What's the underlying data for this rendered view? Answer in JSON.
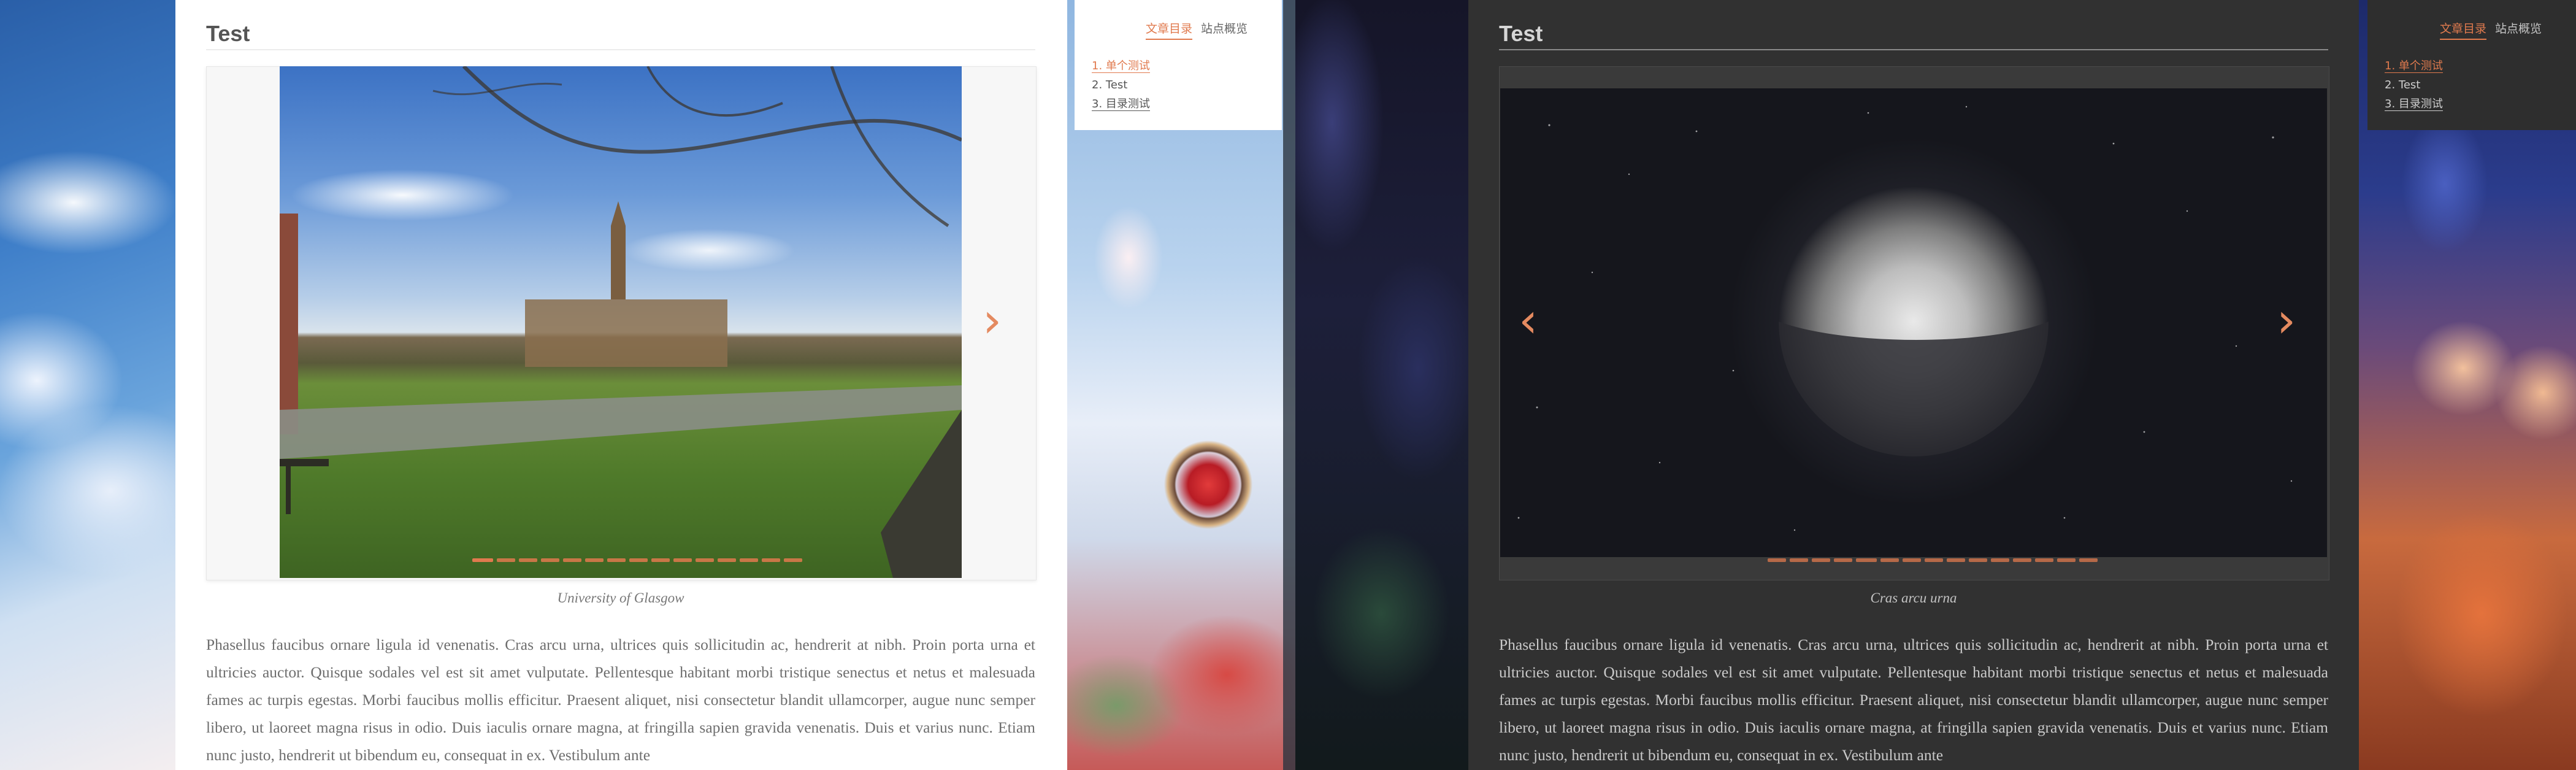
{
  "colors": {
    "accent": "#e07a4e",
    "light_panel": "#ffffff",
    "dark_panel": "#313131"
  },
  "light": {
    "title": "Test",
    "gallery": {
      "slide_caption": "University of Glasgow",
      "slide_count": 15,
      "active_index": 0,
      "next_icon": "chevron-right-icon"
    },
    "paragraph": "Phasellus faucibus ornare ligula id venenatis. Cras arcu urna, ultrices quis sollicitudin ac, hendrerit at nibh. Proin porta urna et ultricies auctor. Quisque sodales vel est sit amet vulputate. Pellentesque habitant morbi tristique senectus et netus et malesuada fames ac turpis egestas. Morbi faucibus mollis efficitur. Praesent aliquet, nisi consectetur blandit ullamcorper, augue nunc semper libero, ut laoreet magna risus in odio. Duis iaculis ornare magna, at fringilla sapien gravida venenatis. Duis et varius nunc. Etiam nunc justo, hendrerit ut bibendum eu, consequat in ex. Vestibulum ante",
    "toc": {
      "tab_toc": "文章目录",
      "tab_overview": "站点概览",
      "items": [
        "1. 单个测试",
        "2. Test",
        "3. 目录测试"
      ]
    }
  },
  "dark": {
    "title": "Test",
    "gallery": {
      "slide_caption": "Cras arcu urna",
      "slide_count": 15,
      "active_index": 4,
      "prev_icon": "chevron-left-icon",
      "next_icon": "chevron-right-icon"
    },
    "paragraph": "Phasellus faucibus ornare ligula id venenatis. Cras arcu urna, ultrices quis sollicitudin ac, hendrerit at nibh. Proin porta urna et ultricies auctor. Quisque sodales vel est sit amet vulputate. Pellentesque habitant morbi tristique senectus et netus et malesuada fames ac turpis egestas. Morbi faucibus mollis efficitur. Praesent aliquet, nisi consectetur blandit ullamcorper, augue nunc semper libero, ut laoreet magna risus in odio. Duis iaculis ornare magna, at fringilla sapien gravida venenatis. Duis et varius nunc. Etiam nunc justo, hendrerit ut bibendum eu, consequat in ex. Vestibulum ante",
    "toc": {
      "tab_toc": "文章目录",
      "tab_overview": "站点概览",
      "items": [
        "1. 单个测试",
        "2. Test",
        "3. 目录测试"
      ]
    }
  }
}
